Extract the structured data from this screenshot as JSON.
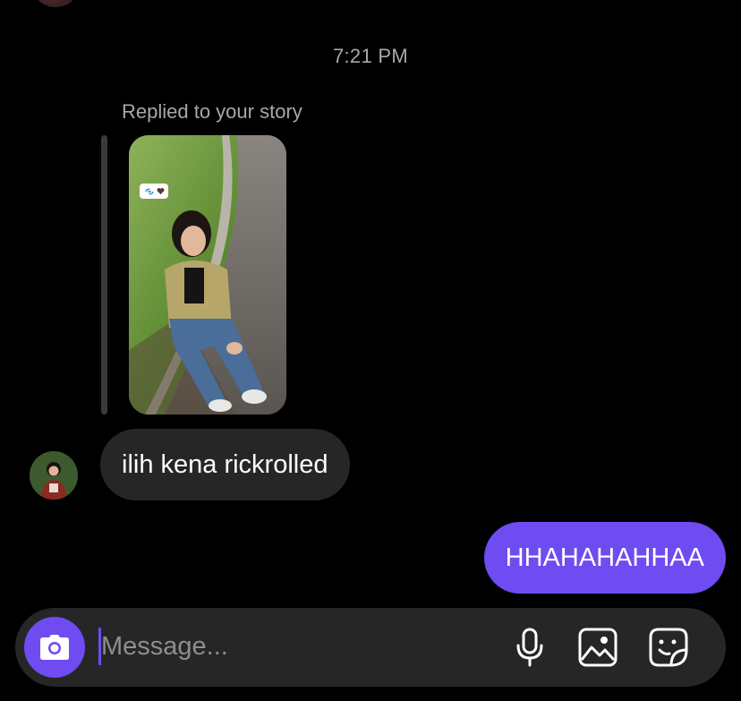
{
  "thread": {
    "timestamp": "7:21 PM",
    "reply_label": "Replied to your story",
    "messages": [
      {
        "direction": "incoming",
        "text": "ilih kena rickrolled"
      },
      {
        "direction": "outgoing",
        "text": "HHAHAHAHHAA"
      }
    ]
  },
  "composer": {
    "placeholder": "Message...",
    "value": "",
    "icons": [
      "camera-icon",
      "microphone-icon",
      "gallery-icon",
      "sticker-icon"
    ]
  },
  "colors": {
    "background": "#000000",
    "incoming_bubble": "#262626",
    "outgoing_bubble": "#6e4cf2",
    "muted_text": "#a8a8a8",
    "composer": "#262626"
  }
}
